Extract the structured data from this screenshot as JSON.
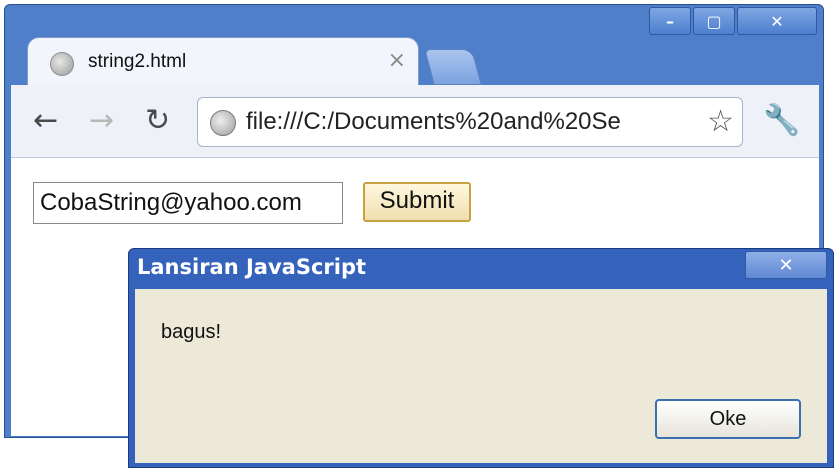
{
  "browser": {
    "tab_title": "string2.html",
    "tab_close": "×",
    "window_controls": {
      "minimize": "–",
      "maximize": "▢",
      "close": "✕"
    },
    "nav": {
      "back": "←",
      "forward": "→",
      "reload": "↻"
    },
    "url": "file:///C:/Documents%20and%20Se",
    "bookmark_star": "☆",
    "wrench": "🔧"
  },
  "page": {
    "email_value": "CobaString@yahoo.com",
    "submit_label": "Submit"
  },
  "dialog": {
    "title": "Lansiran JavaScript",
    "close": "✕",
    "message": "bagus!",
    "ok_label": "Oke"
  },
  "colors": {
    "titlebar": "#4f7fc9",
    "dialog_title": "#3563bc",
    "dialog_body": "#ece9d8",
    "submit_border": "#c8a240"
  },
  "icons": [
    "globe-icon",
    "back-arrow-icon",
    "forward-arrow-icon",
    "reload-icon",
    "star-icon",
    "wrench-icon",
    "close-icon"
  ]
}
